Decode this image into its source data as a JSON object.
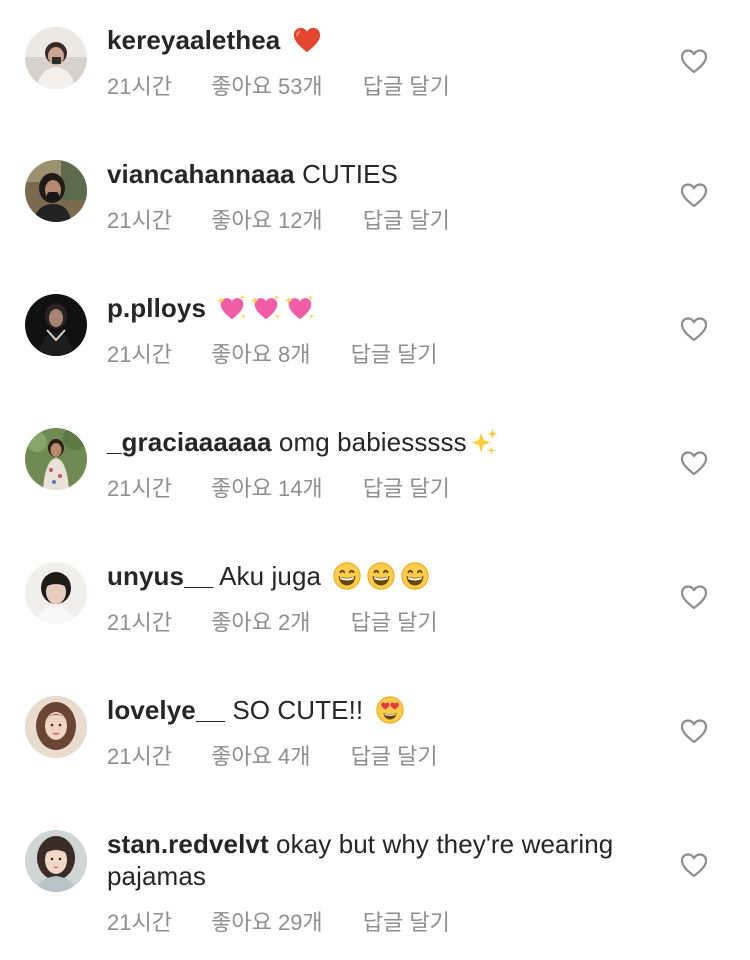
{
  "comments": [
    {
      "username": "kereyaalethea",
      "text": "",
      "emojis": [
        "red-heart"
      ],
      "time": "21시간",
      "likes": "좋아요 53개",
      "reply": "답글 달기"
    },
    {
      "username": "viancahannaaa",
      "text": "CUTIES",
      "emojis": [],
      "time": "21시간",
      "likes": "좋아요 12개",
      "reply": "답글 달기"
    },
    {
      "username": "p.plloys",
      "text": "",
      "emojis": [
        "sparkling-heart",
        "sparkling-heart",
        "sparkling-heart"
      ],
      "time": "21시간",
      "likes": "좋아요 8개",
      "reply": "답글 달기"
    },
    {
      "username": "_graciaaaaaa",
      "text": "omg babiesssss",
      "emojis": [
        "sparkles"
      ],
      "time": "21시간",
      "likes": "좋아요 14개",
      "reply": "답글 달기"
    },
    {
      "username": "unyus__",
      "text": "Aku juga",
      "emojis": [
        "grinning-face",
        "grinning-face",
        "grinning-face"
      ],
      "time": "21시간",
      "likes": "좋아요 2개",
      "reply": "답글 달기"
    },
    {
      "username": "lovelye__",
      "text": "SO CUTE!!",
      "emojis": [
        "heart-eyes-face"
      ],
      "time": "21시간",
      "likes": "좋아요 4개",
      "reply": "답글 달기"
    },
    {
      "username": "stan.redvelvt",
      "text": "okay but why they're wearing pajamas",
      "emojis": [],
      "time": "21시간",
      "likes": "좋아요 29개",
      "reply": "답글 달기"
    }
  ],
  "colors": {
    "text": "#262626",
    "secondary": "#8e8e8e",
    "heart_outline": "#8e8e8e"
  }
}
